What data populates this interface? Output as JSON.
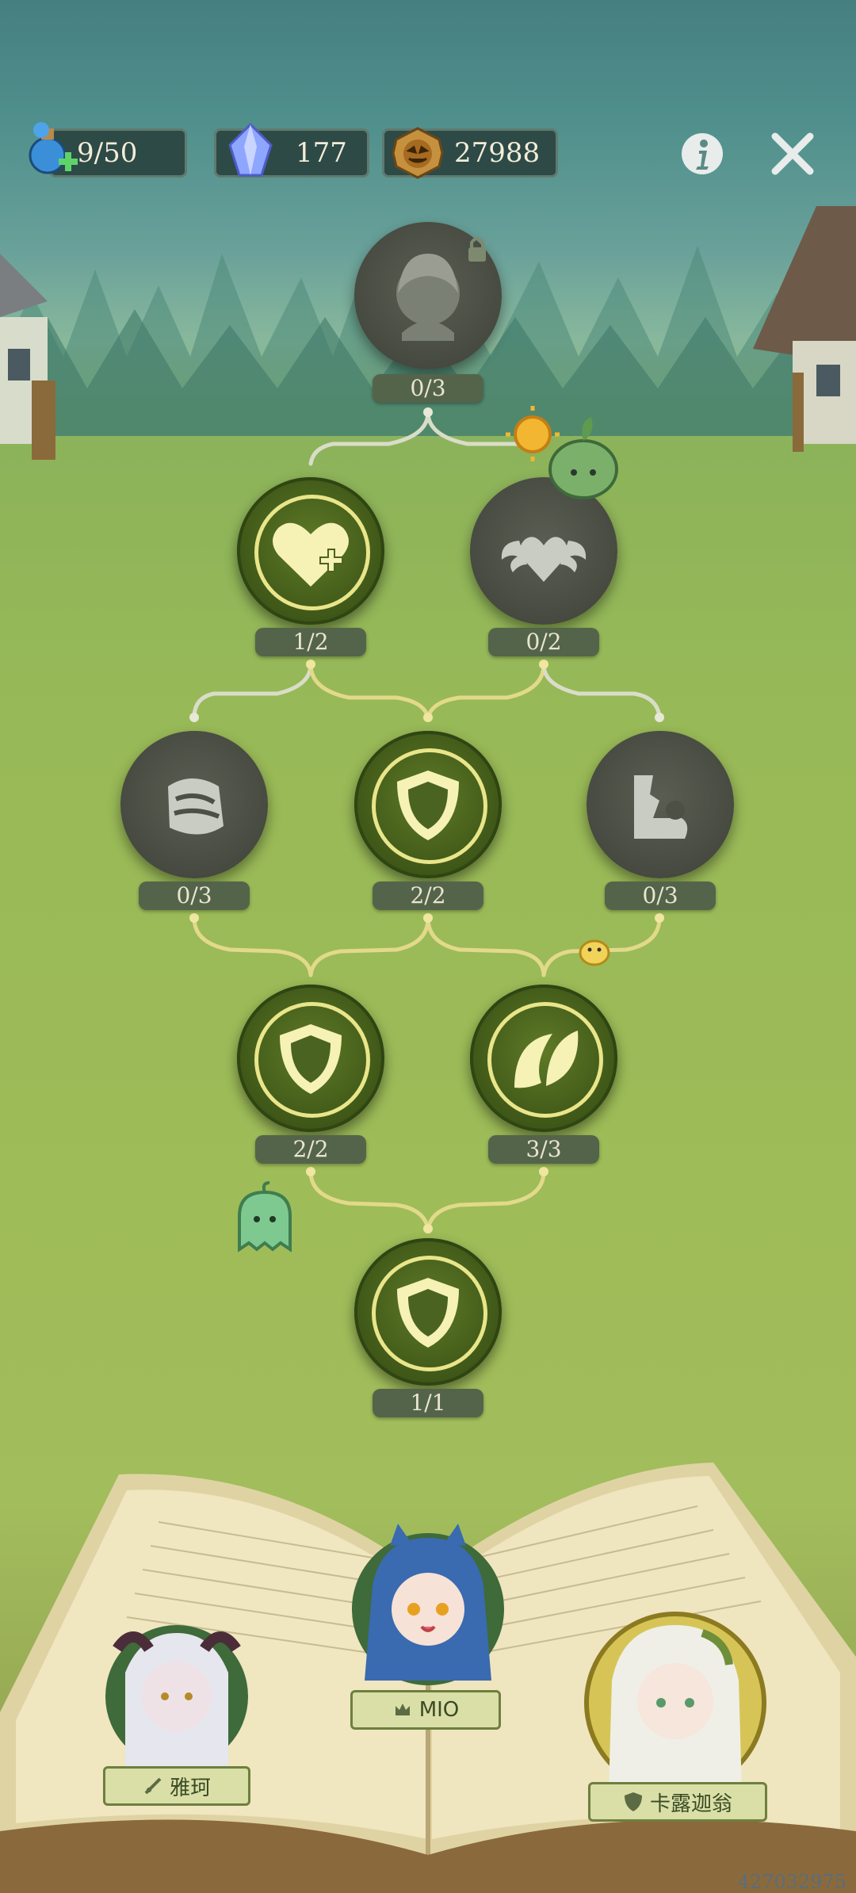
{
  "resources": {
    "stamina": "9/50",
    "crystals": "177",
    "pumpkin_coins": "27988"
  },
  "tree": {
    "top_node": {
      "count": "0/3",
      "state": "locked",
      "icon": "character-portrait-icon"
    },
    "row2": [
      {
        "count": "1/2",
        "state": "active",
        "icon": "heart-plus-icon"
      },
      {
        "count": "0/2",
        "state": "locked",
        "icon": "winged-heart-icon"
      }
    ],
    "row3": [
      {
        "count": "0/3",
        "state": "locked",
        "icon": "bandage-icon"
      },
      {
        "count": "2/2",
        "state": "active",
        "icon": "shield-icon"
      },
      {
        "count": "0/3",
        "state": "locked",
        "icon": "broken-pillar-icon"
      }
    ],
    "row4": [
      {
        "count": "2/2",
        "state": "active",
        "icon": "shield-icon"
      },
      {
        "count": "3/3",
        "state": "active",
        "icon": "leaf-icon"
      }
    ],
    "root_node": {
      "count": "1/1",
      "state": "active",
      "icon": "shield-icon"
    }
  },
  "characters": [
    {
      "name": "雅珂",
      "role_icon": "sword-icon"
    },
    {
      "name": "MIO",
      "role_icon": "crown-icon"
    },
    {
      "name": "卡露迦翁",
      "role_icon": "shield-icon"
    }
  ],
  "footer_code": "427032975",
  "colors": {
    "active_node": "#4a6320",
    "locked_node": "#4d5045",
    "ring": "#e9e58a",
    "line_active": "#e2d98a",
    "line_locked": "#d9ddc8"
  }
}
